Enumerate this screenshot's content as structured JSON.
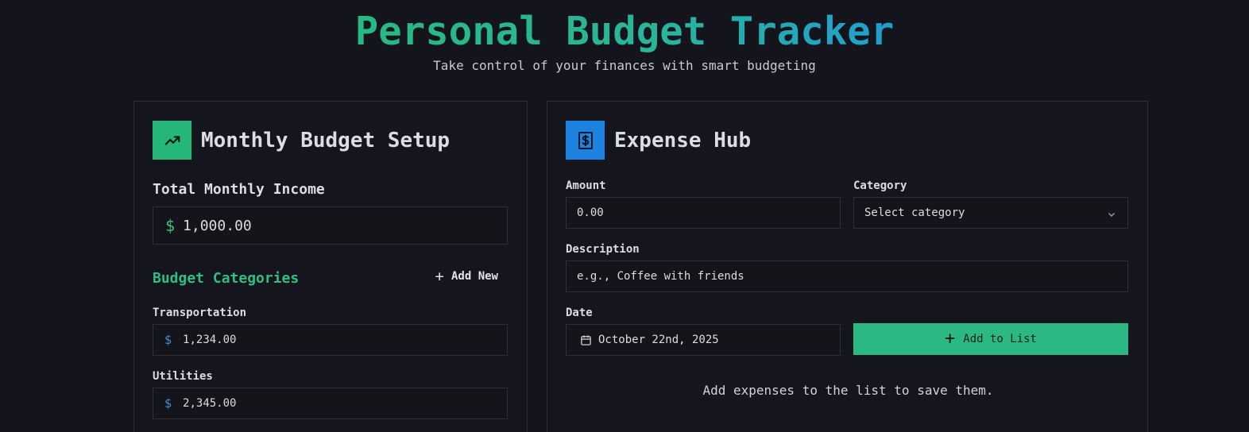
{
  "header": {
    "title": "Personal Budget Tracker",
    "subtitle": "Take control of your finances with smart budgeting"
  },
  "budget_setup": {
    "icon": "trending-up-icon",
    "title": "Monthly Budget Setup",
    "income_label": "Total Monthly Income",
    "income_currency": "$",
    "income_value": "1,000.00",
    "categories_title": "Budget Categories",
    "add_new_label": "Add New",
    "categories": [
      {
        "name": "Transportation",
        "currency": "$",
        "amount": "1,234.00"
      },
      {
        "name": "Utilities",
        "currency": "$",
        "amount": "2,345.00"
      }
    ]
  },
  "expense_hub": {
    "icon": "receipt-dollar-icon",
    "title": "Expense Hub",
    "amount_label": "Amount",
    "amount_value": "0.00",
    "category_label": "Category",
    "category_value": "Select category",
    "description_label": "Description",
    "description_placeholder": "e.g., Coffee with friends",
    "date_label": "Date",
    "date_value": "October 22nd, 2025",
    "add_button_label": "Add to List",
    "empty_message": "Add expenses to the list to save them."
  },
  "colors": {
    "background": "#14141c",
    "accent_green": "#2cb882",
    "accent_blue": "#1c84e0",
    "category_title": "#30be84"
  }
}
